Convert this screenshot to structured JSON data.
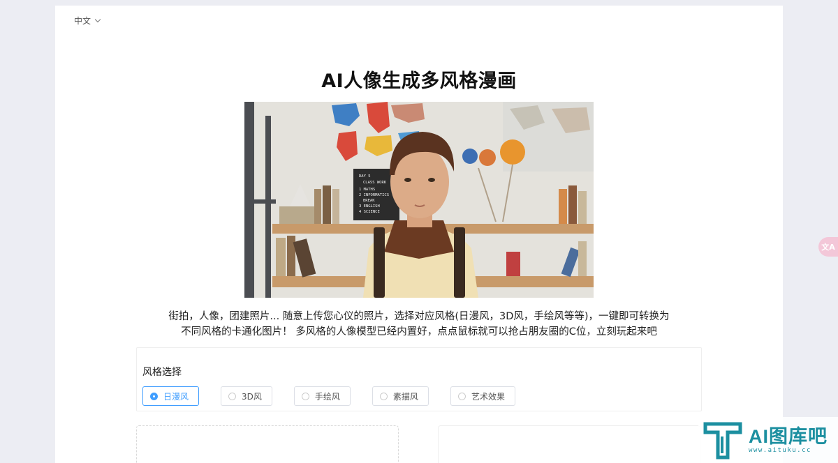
{
  "header": {
    "language": "中文"
  },
  "main": {
    "title_prefix": "AI",
    "title_rest": "人像生成多风格漫画",
    "hero_board": {
      "lines": [
        "DAY 5",
        "CLASS WORK",
        "1 MATHS",
        "2 INFORMATICS",
        "BREAK",
        "3 ENGLISH",
        "4 SCIENCE"
      ]
    },
    "description_line1": "街拍，人像，团建照片... 随意上传您心仪的照片，选择对应风格(日漫风，3D风，手绘风等等)，一键即可转换为",
    "description_line2": "不同风格的卡通化图片！ 多风格的人像模型已经内置好，点点鼠标就可以抢占朋友圈的C位，立刻玩起来吧"
  },
  "style_selector": {
    "label": "风格选择",
    "options": [
      {
        "label": "日漫风",
        "selected": true
      },
      {
        "label": "3D风",
        "selected": false
      },
      {
        "label": "手绘风",
        "selected": false
      },
      {
        "label": "素描风",
        "selected": false
      },
      {
        "label": "艺术效果",
        "selected": false
      }
    ]
  },
  "floating": {
    "translate_label": "文A"
  },
  "watermark": {
    "brand": "AI图库吧",
    "url": "www.aituku.cc"
  },
  "colors": {
    "accent": "#409eff",
    "page_bg": "#ecedf3",
    "brand": "#1c8fa0"
  }
}
